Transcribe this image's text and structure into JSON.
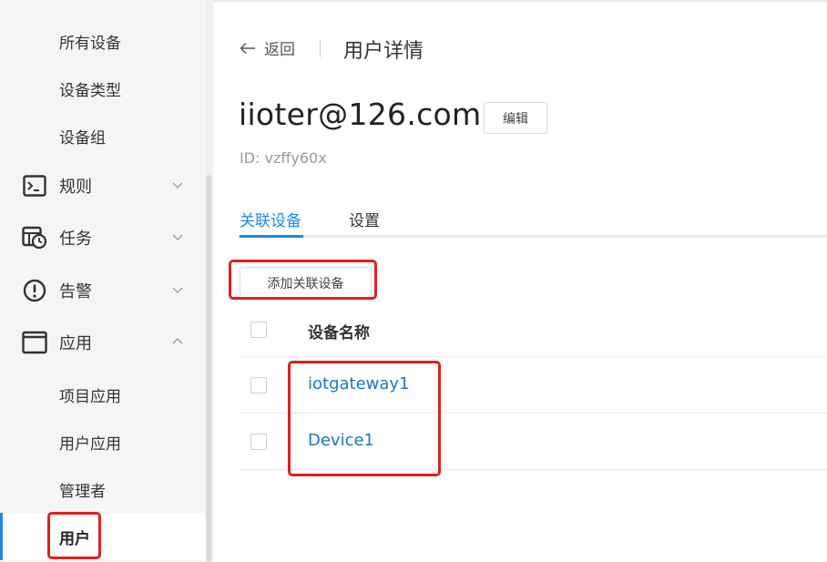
{
  "sidebar": {
    "sub_items_top": [
      "所有设备",
      "设备类型",
      "设备组"
    ],
    "groups": [
      {
        "label": "规则",
        "icon": "terminal-icon",
        "expanded": false
      },
      {
        "label": "任务",
        "icon": "task-schedule-icon",
        "expanded": false
      },
      {
        "label": "告警",
        "icon": "alert-icon",
        "expanded": false
      },
      {
        "label": "应用",
        "icon": "window-icon",
        "expanded": true
      }
    ],
    "app_items": [
      "项目应用",
      "用户应用",
      "管理者",
      "用户"
    ],
    "active_item": "用户"
  },
  "header": {
    "back_label": "返回",
    "title": "用户详情"
  },
  "user": {
    "email": "iioter@126.com",
    "edit_label": "编辑",
    "id_text": "ID: vzffy60x"
  },
  "tabs": [
    {
      "label": "关联设备",
      "active": true
    },
    {
      "label": "设置",
      "active": false
    }
  ],
  "devices": {
    "add_label": "添加关联设备",
    "column_header": "设备名称",
    "rows": [
      {
        "name": "iotgateway1"
      },
      {
        "name": "Device1"
      }
    ]
  },
  "colors": {
    "accent": "#1e88e5",
    "link": "#1e73c8",
    "highlight": "#e02020"
  }
}
